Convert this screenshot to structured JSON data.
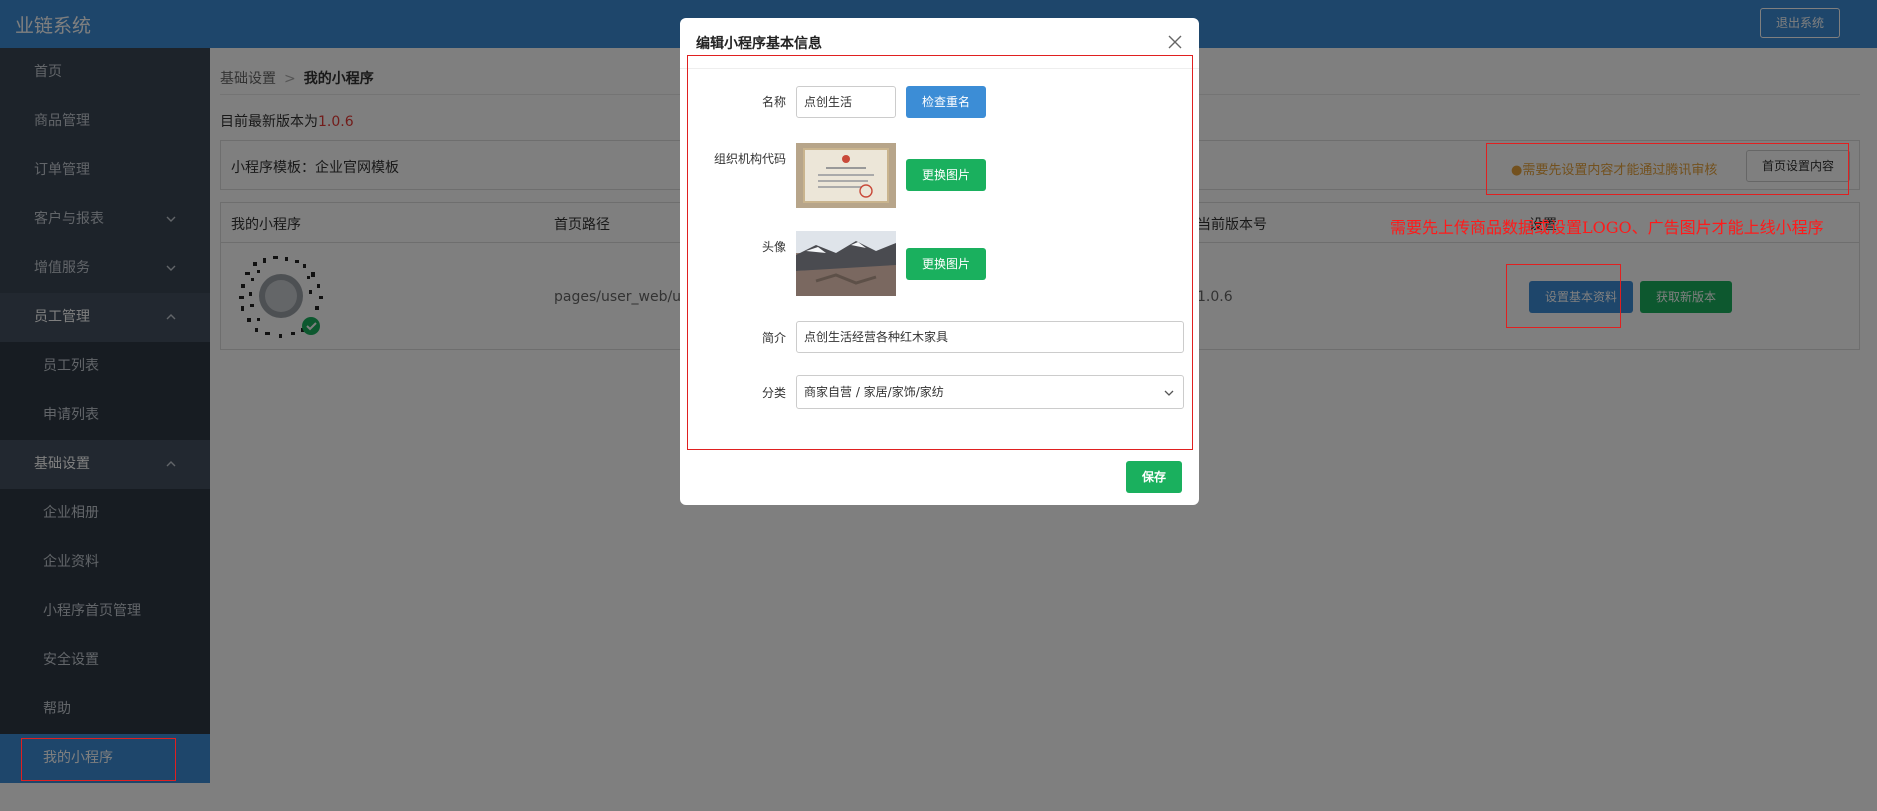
{
  "header": {
    "app_title": "业链系统",
    "logout_label": "退出系统"
  },
  "sidebar": {
    "items": [
      {
        "label": "首页"
      },
      {
        "label": "商品管理"
      },
      {
        "label": "订单管理"
      },
      {
        "label": "客户与报表"
      },
      {
        "label": "增值服务"
      },
      {
        "label": "员工管理"
      },
      {
        "label": "员工列表"
      },
      {
        "label": "申请列表"
      },
      {
        "label": "基础设置"
      },
      {
        "label": "企业相册"
      },
      {
        "label": "企业资料"
      },
      {
        "label": "小程序首页管理"
      },
      {
        "label": "安全设置"
      },
      {
        "label": "帮助"
      },
      {
        "label": "我的小程序"
      }
    ]
  },
  "breadcrumb": {
    "parent": "基础设置",
    "separator": ">",
    "current": "我的小程序"
  },
  "version": {
    "prefix": "目前最新版本为",
    "value": "1.0.6"
  },
  "template": {
    "label": "小程序模板：企业官网模板",
    "warning": "●需要先设置内容才能通过腾讯审核",
    "home_settings_label": "首页设置内容"
  },
  "table": {
    "headers": [
      "我的小程序",
      "首页路径",
      "当前版本号",
      "设置"
    ],
    "row": {
      "path": "pages/user_web/us",
      "version": "1.0.6"
    },
    "set_basic_label": "设置基本资料",
    "new_version_label": "获取新版本"
  },
  "annotation_note": "需要先上传商品数据或设置LOGO、广告图片才能上线小程序",
  "modal": {
    "title": "编辑小程序基本信息",
    "name_label": "名称",
    "name_value": "点创生活",
    "check_name_label": "检查重名",
    "org_code_label": "组织机构代码",
    "change_image_label": "更换图片",
    "avatar_label": "头像",
    "intro_label": "简介",
    "intro_value": "点创生活经营各种红木家具",
    "category_label": "分类",
    "category_value": "商家自营 / 家居/家饰/家纺",
    "save_label": "保存"
  },
  "colors": {
    "accent": "#3c8dd6",
    "success": "#1ab05e",
    "warning": "#e6a23c",
    "annotation": "#e02020"
  }
}
